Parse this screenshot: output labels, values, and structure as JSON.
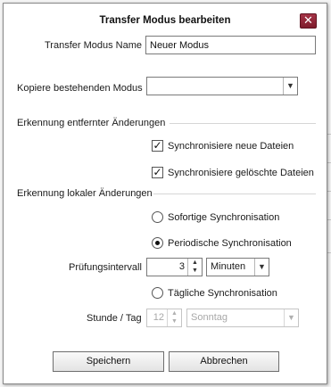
{
  "dialog": {
    "title": "Transfer Modus bearbeiten",
    "close_icon": "close-icon",
    "accent_color": "#8b2233"
  },
  "name_field": {
    "label": "Transfer Modus Name",
    "value": "Neuer Modus"
  },
  "copy_mode": {
    "label": "Kopiere bestehenden Modus",
    "value": ""
  },
  "remote_changes": {
    "section_title": "Erkennung entfernter Änderungen",
    "sync_new": {
      "label": "Synchronisiere neue Dateien",
      "checked": true
    },
    "sync_deleted": {
      "label": "Synchronisiere gelöschte Dateien",
      "checked": true
    }
  },
  "local_changes": {
    "section_title": "Erkennung lokaler Änderungen",
    "immediate": {
      "label": "Sofortige Synchronisation",
      "selected": false
    },
    "periodic": {
      "label": "Periodische Synchronisation",
      "selected": true
    },
    "interval_label": "Prüfungsintervall",
    "interval_value": "3",
    "interval_unit": "Minuten",
    "daily": {
      "label": "Tägliche Synchronisation",
      "selected": false
    },
    "hour_day_label": "Stunde / Tag",
    "hour_value": "12",
    "day_value": "Sonntag"
  },
  "buttons": {
    "save": "Speichern",
    "cancel": "Abbrechen"
  }
}
